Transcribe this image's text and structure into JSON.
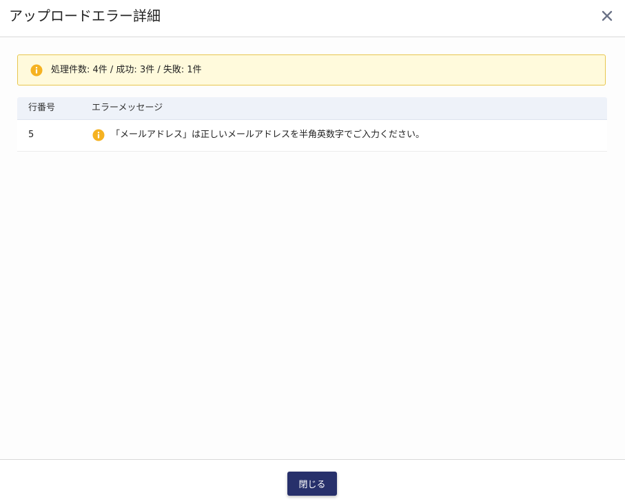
{
  "dialog": {
    "title": "アップロードエラー詳細",
    "close_icon": "close-icon"
  },
  "summary": {
    "icon": "info-icon",
    "text": "処理件数: 4件 / 成功: 3件 / 失敗: 1件",
    "colors": {
      "background": "#fffadc",
      "border": "#e8c64d",
      "icon": "#f5b221"
    }
  },
  "table": {
    "headers": {
      "row_number": "行番号",
      "message": "エラーメッセージ"
    },
    "rows": [
      {
        "row_number": "5",
        "icon": "warning-icon",
        "message": "「メールアドレス」は正しいメールアドレスを半角英数字でご入力ください。"
      }
    ]
  },
  "footer": {
    "close_label": "閉じる",
    "button_color": "#27306b"
  }
}
